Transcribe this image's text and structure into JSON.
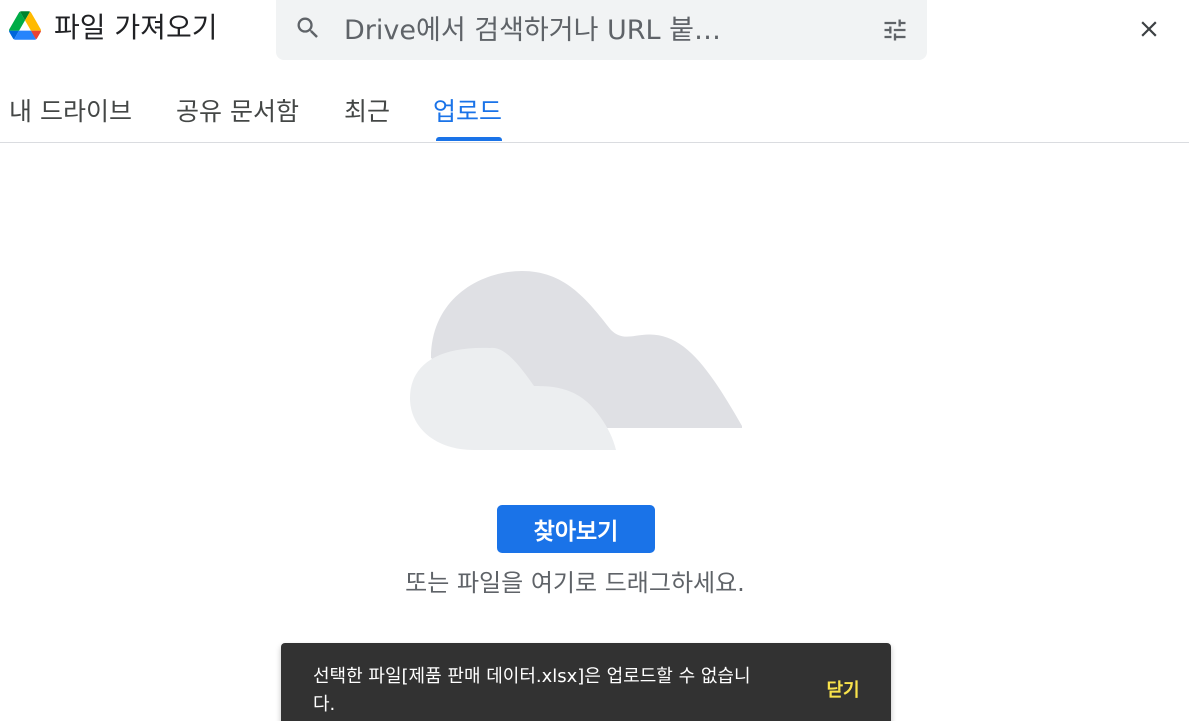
{
  "header": {
    "title": "파일 가져오기",
    "search": {
      "placeholder": "Drive에서 검색하거나 URL 붙…"
    }
  },
  "tabs": [
    {
      "label": "내 드라이브",
      "active": false
    },
    {
      "label": "공유 문서함",
      "active": false
    },
    {
      "label": "최근",
      "active": false
    },
    {
      "label": "업로드",
      "active": true
    }
  ],
  "upload": {
    "browse_label": "찾아보기",
    "drag_hint": "또는 파일을 여기로 드래그하세요."
  },
  "snackbar": {
    "message": "선택한 파일[제품 판매 데이터.xlsx]은 업로드할 수 없습니다.",
    "dismiss_label": "닫기"
  },
  "colors": {
    "accent": "#1a73e8",
    "snackbar_bg": "#323232",
    "snackbar_action": "#f9e34b",
    "search_bg": "#f1f3f4"
  },
  "icons": [
    "google-drive-logo",
    "search-icon",
    "filter-icon",
    "close-icon",
    "cloud-illustration"
  ]
}
